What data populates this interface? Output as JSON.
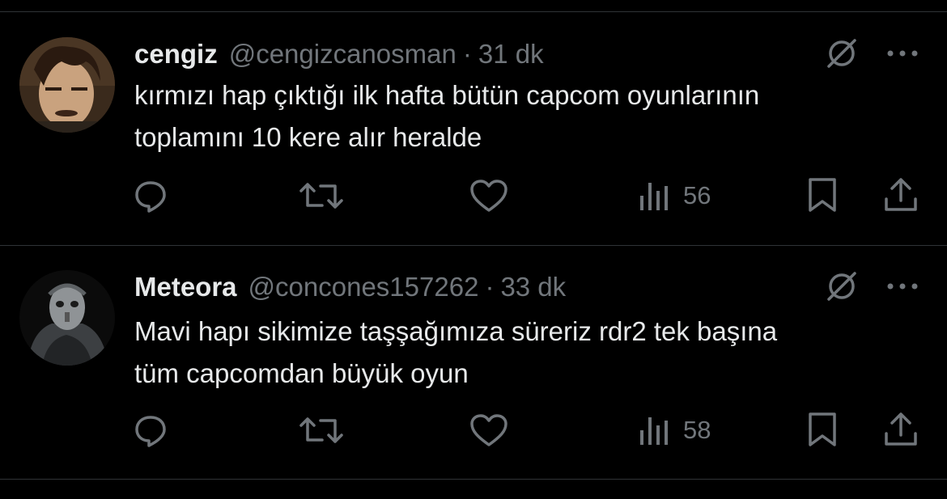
{
  "colors": {
    "background": "#000000",
    "primary_text": "#e7e9ea",
    "secondary_text": "#71767b",
    "divider": "#2f3336"
  },
  "tweets": [
    {
      "display_name": "cengiz",
      "handle": "@cengizcanosman",
      "separator": "·",
      "time": "31 dk",
      "text_lines": [
        "kırmızı hap çıktığı ilk hafta bütün capcom oyunlarının",
        "toplamını 10 kere alır heralde"
      ],
      "views": "56",
      "icons": {
        "reply": "reply-icon",
        "retweet": "retweet-icon",
        "like": "heart-icon",
        "views": "views-chart-icon",
        "bookmark": "bookmark-icon",
        "share": "share-icon",
        "grok": "grok-icon",
        "more": "more-icon"
      }
    },
    {
      "display_name": "Meteora",
      "handle": "@concones157262",
      "separator": "·",
      "time": "33 dk",
      "text_lines": [
        "Mavi hapı sikimize taşşağımıza süreriz rdr2 tek başına",
        "tüm capcomdan büyük oyun"
      ],
      "views": "58",
      "icons": {
        "reply": "reply-icon",
        "retweet": "retweet-icon",
        "like": "heart-icon",
        "views": "views-chart-icon",
        "bookmark": "bookmark-icon",
        "share": "share-icon",
        "grok": "grok-icon",
        "more": "more-icon"
      }
    }
  ]
}
